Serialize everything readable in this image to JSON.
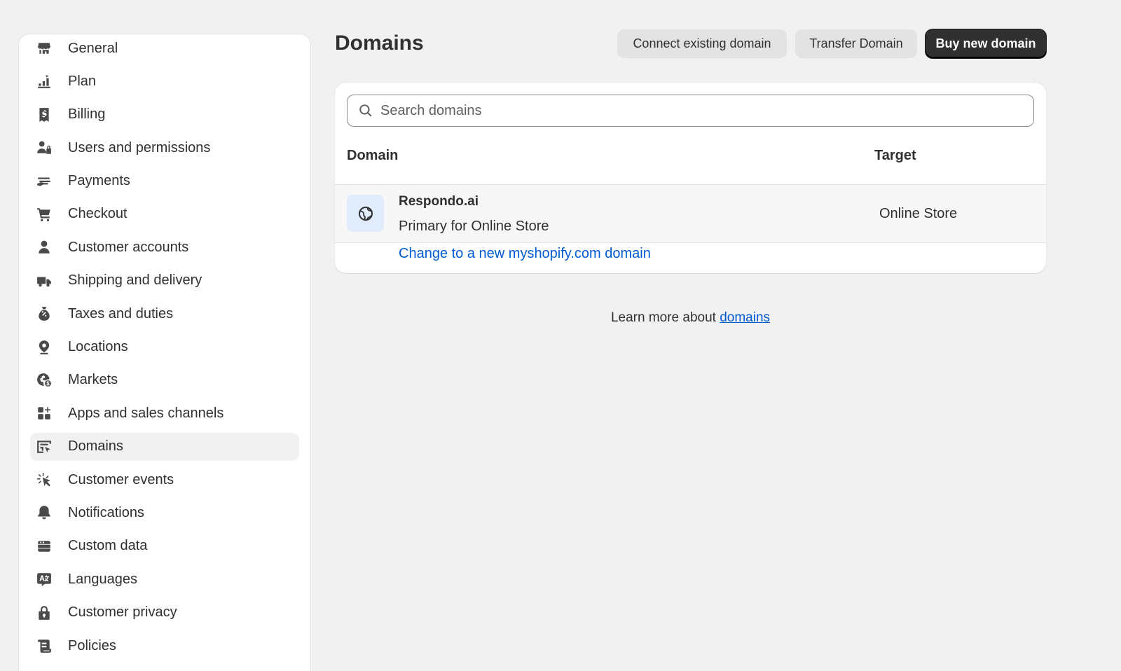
{
  "sidebar": {
    "items": [
      {
        "label": "General",
        "icon": "store-icon"
      },
      {
        "label": "Plan",
        "icon": "plan-icon"
      },
      {
        "label": "Billing",
        "icon": "billing-icon"
      },
      {
        "label": "Users and permissions",
        "icon": "users-icon"
      },
      {
        "label": "Payments",
        "icon": "payments-icon"
      },
      {
        "label": "Checkout",
        "icon": "cart-icon"
      },
      {
        "label": "Customer accounts",
        "icon": "person-icon"
      },
      {
        "label": "Shipping and delivery",
        "icon": "truck-icon"
      },
      {
        "label": "Taxes and duties",
        "icon": "tax-icon"
      },
      {
        "label": "Locations",
        "icon": "location-icon"
      },
      {
        "label": "Markets",
        "icon": "globe-dollar-icon"
      },
      {
        "label": "Apps and sales channels",
        "icon": "apps-icon"
      },
      {
        "label": "Domains",
        "icon": "domain-icon",
        "active": true
      },
      {
        "label": "Customer events",
        "icon": "cursor-click-icon"
      },
      {
        "label": "Notifications",
        "icon": "bell-icon"
      },
      {
        "label": "Custom data",
        "icon": "database-icon"
      },
      {
        "label": "Languages",
        "icon": "language-icon"
      },
      {
        "label": "Customer privacy",
        "icon": "lock-icon"
      },
      {
        "label": "Policies",
        "icon": "policy-icon"
      }
    ]
  },
  "header": {
    "title": "Domains",
    "connect_label": "Connect existing domain",
    "transfer_label": "Transfer Domain",
    "buy_label": "Buy new domain"
  },
  "search": {
    "placeholder": "Search domains",
    "value": ""
  },
  "table": {
    "columns": [
      "Domain",
      "Target"
    ],
    "rows": [
      {
        "name": "Respondo.ai",
        "subtitle": "Primary for Online Store",
        "target": "Online Store",
        "icon": "globe-icon"
      }
    ],
    "change_link": "Change to a new myshopify.com domain"
  },
  "footer": {
    "learn_text": "Learn more about ",
    "learn_link": "domains"
  },
  "colors": {
    "accent_link": "#005bd3",
    "primary_button": "#303030",
    "icon_tile": "#e0ecfb"
  }
}
